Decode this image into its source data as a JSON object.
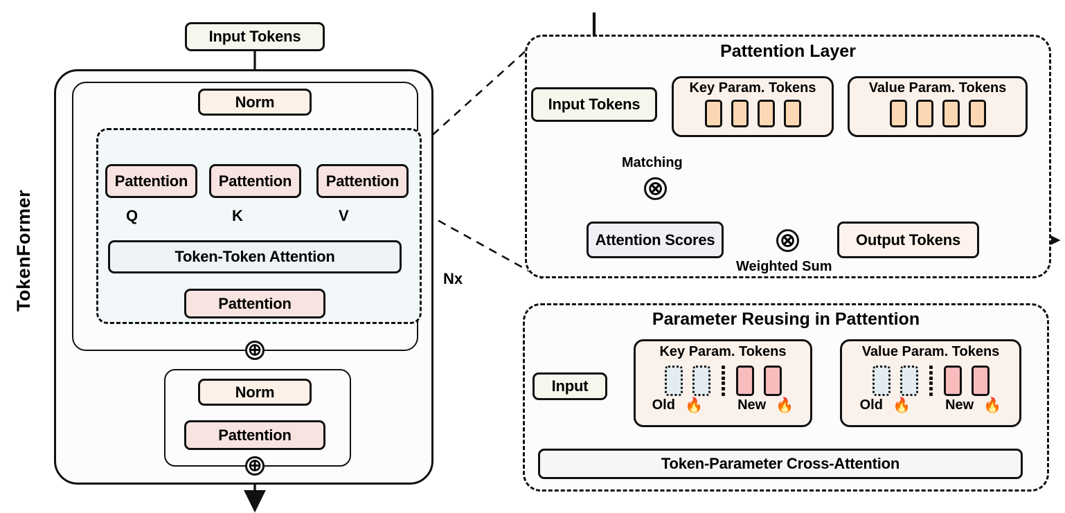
{
  "figure": {
    "left_panel": {
      "vertical_title": "TokenFormer",
      "input_box": "Input Tokens",
      "norm_top": "Norm",
      "pattention_q": "Pattention",
      "pattention_k": "Pattention",
      "pattention_v": "Pattention",
      "label_q": "Q",
      "label_k": "K",
      "label_v": "V",
      "token_token_attention": "Token-Token Attention",
      "pattention_proj": "Pattention",
      "repeat_label": "Nx",
      "norm_bottom": "Norm",
      "pattention_ffn": "Pattention",
      "add_symbol": "⊕"
    },
    "pattention_layer_panel": {
      "title": "Pattention Layer",
      "input_tokens": "Input Tokens",
      "key_param_group": {
        "title": "Key Param. Tokens",
        "chip_count": 4,
        "chip_color": "#fbd8b3"
      },
      "value_param_group": {
        "title": "Value Param. Tokens",
        "chip_count": 4,
        "chip_color": "#fbd8b3"
      },
      "matching_label": "Matching",
      "attention_scores": "Attention Scores",
      "weighted_sum_label": "Weighted Sum",
      "output_tokens": "Output Tokens",
      "multiply_symbol": "⊗"
    },
    "parameter_reusing_panel": {
      "title": "Parameter Reusing in Pattention",
      "input": "Input",
      "key_param_group": {
        "title": "Key Param. Tokens",
        "old_label": "Old",
        "new_label": "New",
        "old_count": 2,
        "new_count": 2,
        "old_color": "#e2ecf1",
        "new_color": "#f8bcbd",
        "flame_glyph": "🔥"
      },
      "value_param_group": {
        "title": "Value Param. Tokens",
        "old_label": "Old",
        "new_label": "New",
        "old_count": 2,
        "new_count": 2,
        "old_color": "#e2ecf1",
        "new_color": "#f8bcbd",
        "flame_glyph": "🔥"
      },
      "cross_attention": "Token-Parameter Cross-Attention"
    },
    "colors": {
      "stroke": "#111111",
      "input_fill": "#f4f8ec",
      "norm_fill": "#fdf1e7",
      "pattention_fill": "#f7e3df",
      "token_attention_fill": "#edf2f5",
      "attention_scores_fill": "#f1eff6",
      "output_tokens_fill": "#fdf3ec",
      "param_group_fill": "#fbf1eb",
      "dashed_region_fill": "#f2f8f9",
      "flame_red": "#f01414"
    }
  }
}
